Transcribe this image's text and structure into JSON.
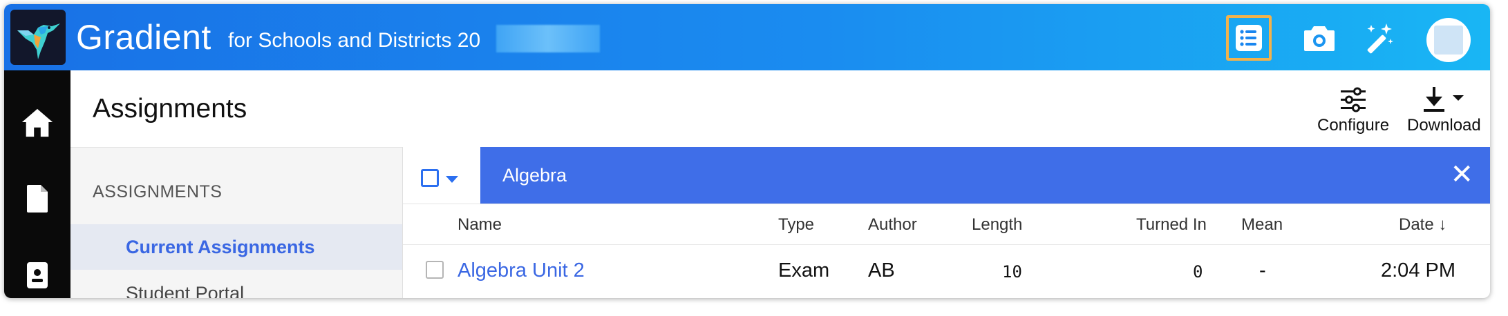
{
  "app": {
    "brand": "Gradient",
    "subtitle": "for Schools and Districts 20"
  },
  "topbar_icons": [
    {
      "name": "assignments-list-icon",
      "active": true
    },
    {
      "name": "camera-icon",
      "active": false
    },
    {
      "name": "magic-wand-icon",
      "active": false
    },
    {
      "name": "avatar",
      "active": false
    }
  ],
  "rail_icons": [
    "home-icon",
    "document-icon",
    "student-badge-icon"
  ],
  "page": {
    "title": "Assignments",
    "actions": {
      "configure_label": "Configure",
      "download_label": "Download"
    }
  },
  "sidenav": {
    "heading": "ASSIGNMENTS",
    "items": [
      {
        "label": "Current Assignments",
        "active": true
      },
      {
        "label": "Student Portal",
        "active": false
      }
    ]
  },
  "filter": {
    "chip_label": "Algebra",
    "close_glyph": "✕"
  },
  "table": {
    "columns": {
      "name": "Name",
      "type": "Type",
      "author": "Author",
      "length": "Length",
      "turned_in": "Turned In",
      "mean": "Mean",
      "date": "Date ↓"
    },
    "rows": [
      {
        "name": "Algebra Unit 2",
        "type": "Exam",
        "author": "AB",
        "length": "10",
        "turned_in": "0",
        "mean": "-",
        "date": "2:04 PM"
      }
    ]
  },
  "colors": {
    "topbar_start": "#1971e6",
    "topbar_end": "#19b6f4",
    "accent_blue": "#3f6ee8",
    "active_highlight": "#f2b24c",
    "rail": "#0a0a0a"
  }
}
